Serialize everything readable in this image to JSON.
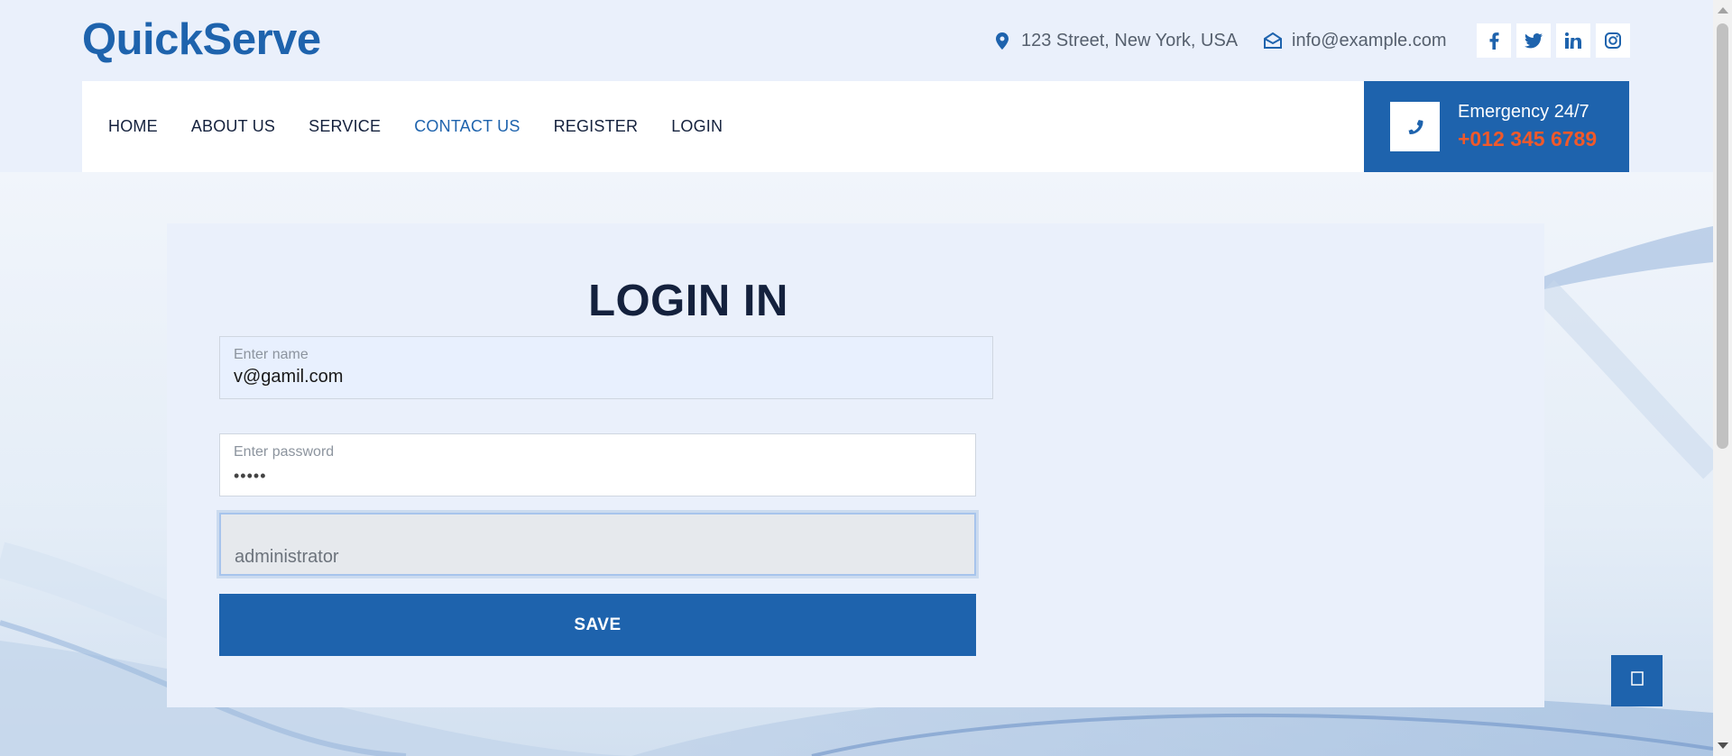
{
  "brand": "QuickServe",
  "contact": {
    "address": "123 Street, New York, USA",
    "email": "info@example.com"
  },
  "socials": [
    {
      "name": "facebook-icon",
      "glyph": "f"
    },
    {
      "name": "twitter-icon",
      "glyph": "t"
    },
    {
      "name": "linkedin-icon",
      "glyph": "in"
    },
    {
      "name": "instagram-icon",
      "glyph": "ig"
    }
  ],
  "nav": {
    "items": [
      "HOME",
      "ABOUT US",
      "SERVICE",
      "CONTACT US",
      "REGISTER",
      "LOGIN"
    ],
    "active": "CONTACT US"
  },
  "emergency": {
    "label": "Emergency 24/7",
    "phone": "+012 345 6789"
  },
  "form": {
    "title": "LOGIN IN",
    "name_label": "Enter name",
    "name_value": "v@gamil.com",
    "password_label": "Enter password",
    "password_value": "•••••",
    "role_value": "administrator",
    "save_label": "SAVE"
  },
  "colors": {
    "primary": "#1e63ad",
    "accent": "#f0592a",
    "dark": "#14213d",
    "background": "#eaf0fb"
  }
}
